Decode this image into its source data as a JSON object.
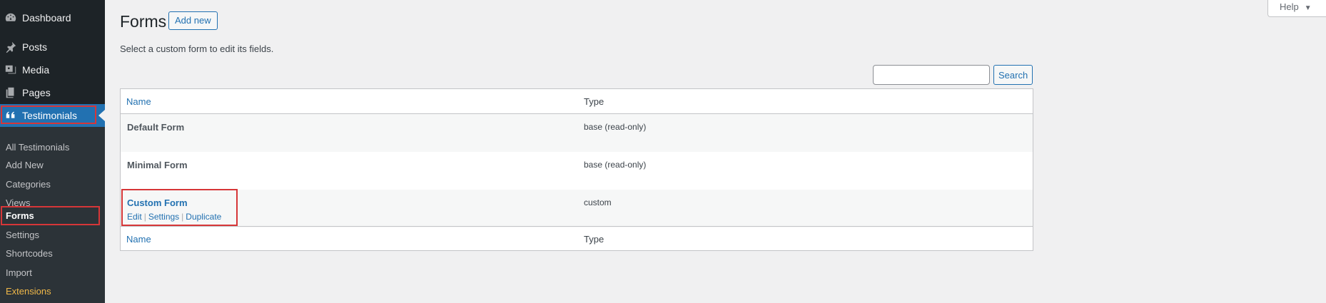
{
  "sidebar": {
    "top_items": [
      {
        "label": "Dashboard",
        "icon": "dashboard-icon"
      },
      {
        "label": "Posts",
        "icon": "pin-icon"
      },
      {
        "label": "Media",
        "icon": "media-icon"
      },
      {
        "label": "Pages",
        "icon": "pages-icon"
      },
      {
        "label": "Testimonials",
        "icon": "quote-icon"
      }
    ],
    "submenu": [
      {
        "label": "All Testimonials"
      },
      {
        "label": "Add New"
      },
      {
        "label": "Categories"
      },
      {
        "label": "Views"
      },
      {
        "label": "Forms"
      },
      {
        "label": "Settings"
      },
      {
        "label": "Shortcodes"
      },
      {
        "label": "Import"
      },
      {
        "label": "Extensions"
      }
    ]
  },
  "header": {
    "title": "Forms",
    "add_new_label": "Add new",
    "description": "Select a custom form to edit its fields.",
    "help_label": "Help"
  },
  "search": {
    "placeholder": "",
    "value": "",
    "button_label": "Search"
  },
  "table": {
    "columns": {
      "name": "Name",
      "type": "Type"
    },
    "rows": [
      {
        "name": "Default Form",
        "type": "base (read-only)"
      },
      {
        "name": "Minimal Form",
        "type": "base (read-only)"
      },
      {
        "name": "Custom Form",
        "type": "custom",
        "actions": [
          "Edit",
          "Settings",
          "Duplicate"
        ]
      }
    ]
  },
  "colors": {
    "sidebar_bg": "#1d2327",
    "accent": "#2271b1",
    "highlight_outline": "#d63638",
    "extensions": "#f0b849"
  }
}
